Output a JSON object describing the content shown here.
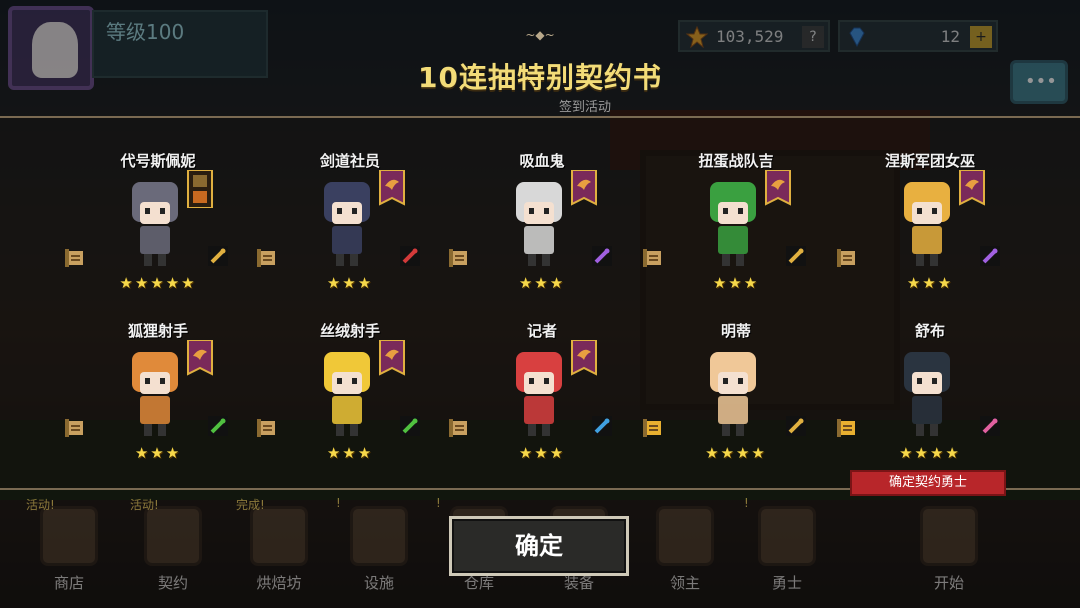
{
  "hud": {
    "level": "等级100",
    "gold": "103,529",
    "gems": "12",
    "gold_help": "?",
    "gem_add": "+",
    "chat_icon": "speech-bubble-icon"
  },
  "title": {
    "ornament": "~◆~",
    "text": "10连抽特别契约书",
    "event": "签到活动"
  },
  "colors": {
    "title": "#f3dc78",
    "star": "#f6d84a",
    "banner": "#7a2a5a",
    "confirm_tag": "#b8262a"
  },
  "characters": [
    {
      "name": "代号斯佩妮",
      "stars": "★★★★★",
      "weapon_icon": "sword-icon",
      "weapon_color": "#e0b040",
      "banner": "gold-emblem",
      "sprite": "#6a6a7a"
    },
    {
      "name": "剑道社员",
      "stars": "★★★",
      "weapon_icon": "crossed-swords-icon",
      "weapon_color": "#d23a3a",
      "banner": "purple-banner",
      "sprite": "#3a4060"
    },
    {
      "name": "吸血鬼",
      "stars": "★★★",
      "weapon_icon": "staff-icon",
      "weapon_color": "#a060e0",
      "banner": "purple-banner",
      "sprite": "#d8d8d8"
    },
    {
      "name": "扭蛋战队吉",
      "stars": "★★★",
      "weapon_icon": "sword-icon",
      "weapon_color": "#e0b040",
      "banner": "purple-banner",
      "sprite": "#3aa040"
    },
    {
      "name": "涅斯军团女巫",
      "stars": "★★★",
      "weapon_icon": "staff-icon",
      "weapon_color": "#a060e0",
      "banner": "purple-banner",
      "sprite": "#e8b040"
    },
    {
      "name": "狐狸射手",
      "stars": "★★★",
      "weapon_icon": "crossbow-icon",
      "weapon_color": "#50c040",
      "banner": "purple-banner",
      "sprite": "#e08a3a"
    },
    {
      "name": "丝绒射手",
      "stars": "★★★",
      "weapon_icon": "crossbow-icon",
      "weapon_color": "#50c040",
      "banner": "purple-banner",
      "sprite": "#f0c838"
    },
    {
      "name": "记者",
      "stars": "★★★",
      "weapon_icon": "gem-icon",
      "weapon_color": "#40a0e0",
      "banner": "purple-banner",
      "sprite": "#d84040"
    },
    {
      "name": "明蒂",
      "stars": "★★★★",
      "weapon_icon": "sword-icon",
      "weapon_color": "#e0b040",
      "banner": "none",
      "sprite": "#f0c898"
    },
    {
      "name": "舒布",
      "stars": "★★★★",
      "weapon_icon": "holy-symbol-icon",
      "weapon_color": "#e060a0",
      "banner": "none",
      "sprite": "#2a3440"
    }
  ],
  "confirm_tag": "确定契约勇士",
  "confirm_button": "确定",
  "nav": [
    {
      "label": "商店",
      "badge": "活动!"
    },
    {
      "label": "契约",
      "badge": "活动!"
    },
    {
      "label": "烘焙坊",
      "badge": "完成!"
    },
    {
      "label": "设施",
      "badge": "!"
    },
    {
      "label": "仓库",
      "badge": "!"
    },
    {
      "label": "装备",
      "badge": ""
    },
    {
      "label": "领主",
      "badge": ""
    },
    {
      "label": "勇士",
      "badge": "!"
    },
    {
      "label": "开始",
      "badge": ""
    }
  ]
}
